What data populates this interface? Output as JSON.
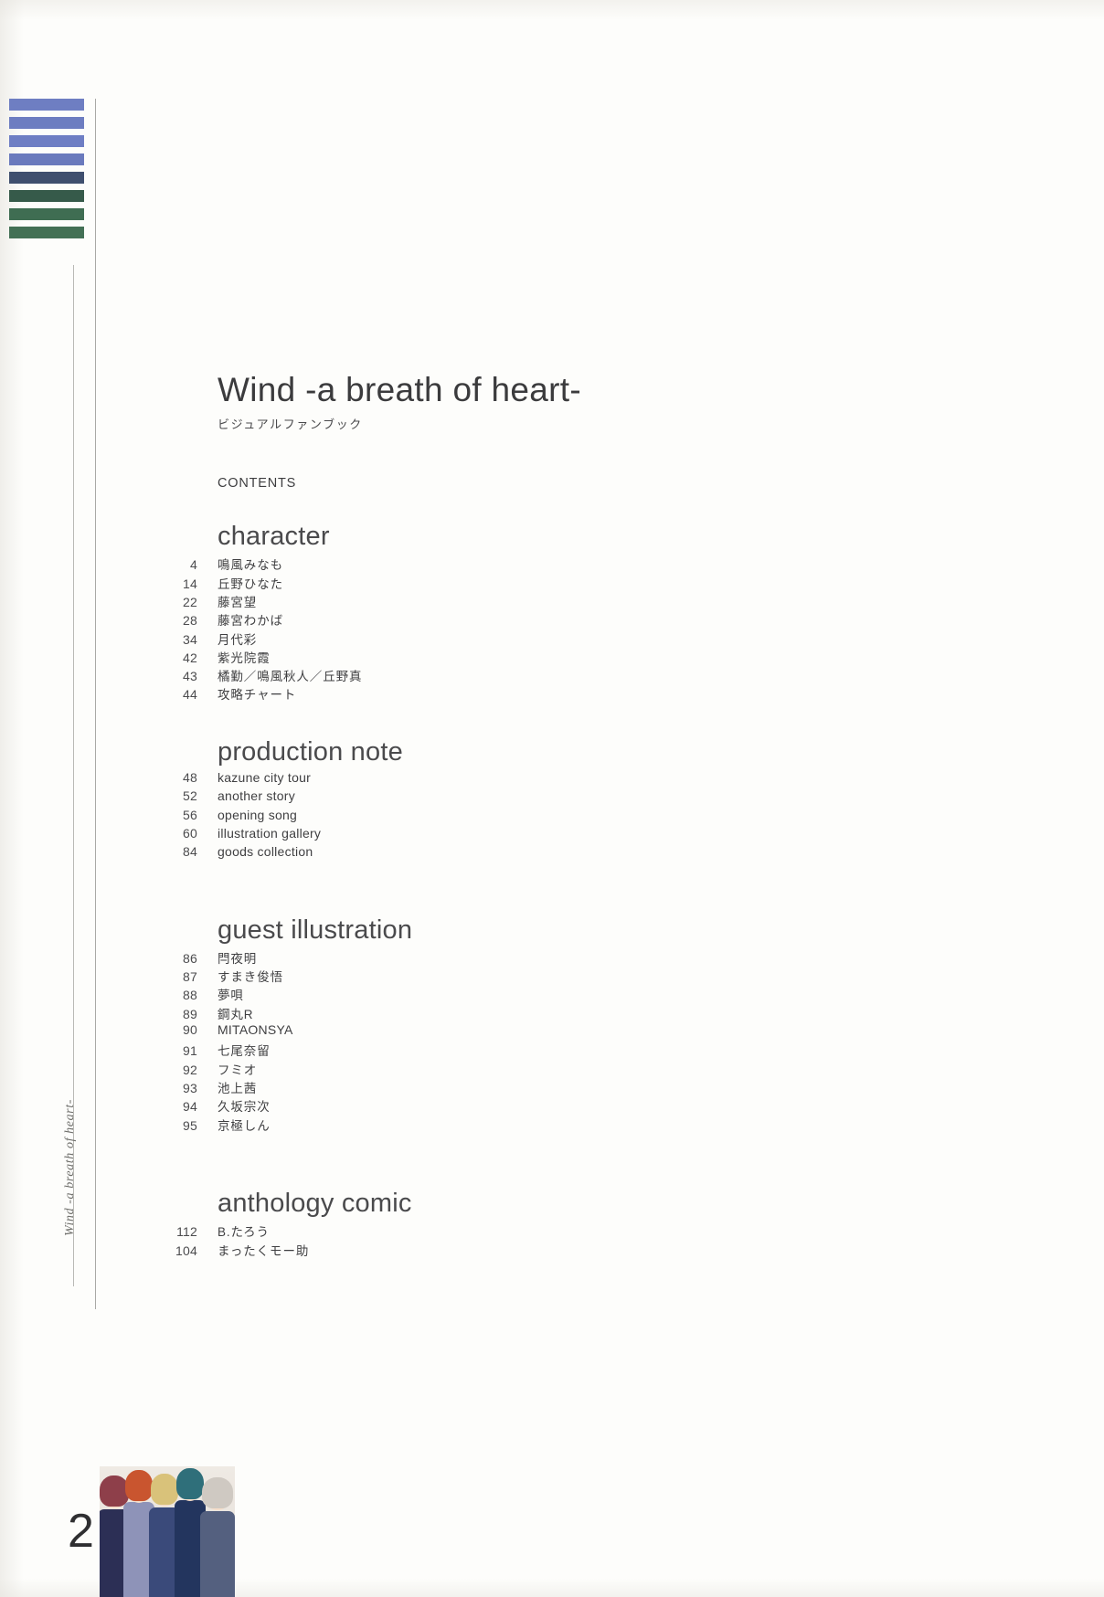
{
  "book": {
    "title": "Wind -a breath of heart-",
    "subtitle": "ビジュアルファンブック",
    "contents_label": "CONTENTS",
    "spine_script": "Wind -a breath of heart-",
    "page_number": "2"
  },
  "colors": {
    "bars": [
      "#6e7ec2",
      "#6d7dc1",
      "#6e7ec4",
      "#6a7abd",
      "#3f4f6e",
      "#365a4a",
      "#3f6d52",
      "#437055"
    ],
    "text_primary": "#3f3f41",
    "heading": "#4a4a4c",
    "rule": "#b9b9b5"
  },
  "sections": [
    {
      "heading": "character",
      "entries": [
        {
          "page": "4",
          "title": "鳴風みなも",
          "jp": true
        },
        {
          "page": "14",
          "title": "丘野ひなた",
          "jp": true
        },
        {
          "page": "22",
          "title": "藤宮望",
          "jp": true
        },
        {
          "page": "28",
          "title": "藤宮わかば",
          "jp": true
        },
        {
          "page": "34",
          "title": "月代彩",
          "jp": true
        },
        {
          "page": "42",
          "title": "紫光院霞",
          "jp": true
        },
        {
          "page": "43",
          "title": "橘勤／鳴風秋人／丘野真",
          "jp": true
        },
        {
          "page": "44",
          "title": "攻略チャート",
          "jp": true
        }
      ]
    },
    {
      "heading": "production note",
      "entries": [
        {
          "page": "48",
          "title": "kazune city tour",
          "jp": false
        },
        {
          "page": "52",
          "title": "another story",
          "jp": false
        },
        {
          "page": "56",
          "title": "opening song",
          "jp": false
        },
        {
          "page": "60",
          "title": "illustration gallery",
          "jp": false
        },
        {
          "page": "84",
          "title": "goods collection",
          "jp": false
        }
      ]
    },
    {
      "heading": "guest illustration",
      "entries": [
        {
          "page": "86",
          "title": "閂夜明",
          "jp": true
        },
        {
          "page": "87",
          "title": "すまき俊悟",
          "jp": true
        },
        {
          "page": "88",
          "title": "夢唄",
          "jp": true
        },
        {
          "page": "89",
          "title": "鋼丸R",
          "jp": true
        },
        {
          "page": "90",
          "title": "MITAONSYA",
          "jp": false
        },
        {
          "page": "91",
          "title": "七尾奈留",
          "jp": true
        },
        {
          "page": "92",
          "title": "フミオ",
          "jp": true
        },
        {
          "page": "93",
          "title": "池上茜",
          "jp": true
        },
        {
          "page": "94",
          "title": "久坂宗次",
          "jp": true
        },
        {
          "page": "95",
          "title": "京極しん",
          "jp": true
        }
      ]
    },
    {
      "heading": "anthology comic",
      "entries": [
        {
          "page": "112",
          "title": "B.たろう",
          "jp": true
        },
        {
          "page": "104",
          "title": "まったくモー助",
          "jp": true
        }
      ]
    }
  ]
}
